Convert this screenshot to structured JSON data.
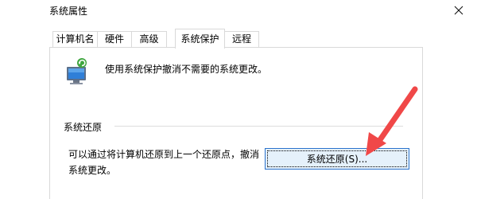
{
  "window": {
    "title": "系统属性"
  },
  "tabs": [
    {
      "label": "计算机名"
    },
    {
      "label": "硬件"
    },
    {
      "label": "高级"
    },
    {
      "label": "系统保护",
      "active": true
    },
    {
      "label": "远程"
    }
  ],
  "protection": {
    "description": "使用系统保护撤消不需要的系统更改。",
    "icon": "system-protection-icon"
  },
  "restore": {
    "section_label": "系统还原",
    "text_line1": "可以通过将计算机还原到上一个还原点，撤消",
    "text_line2": "系统更改。",
    "button_label": "系统还原(S)..."
  },
  "annotation": {
    "arrow_color": "#f04848"
  }
}
